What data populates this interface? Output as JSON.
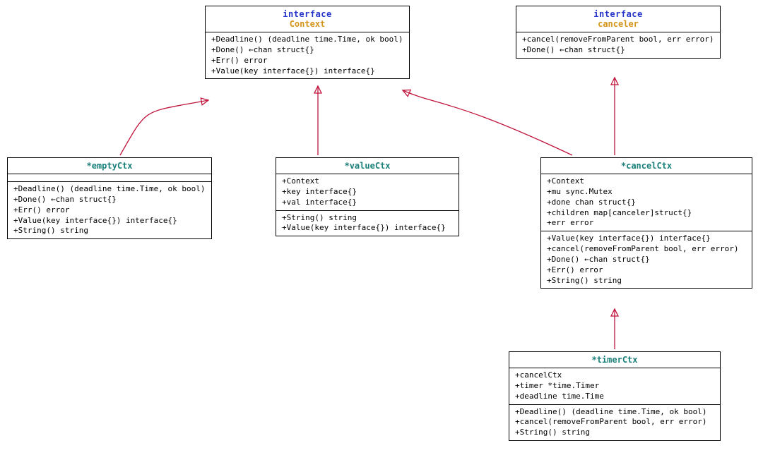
{
  "stereotype_label": "interface",
  "boxes": {
    "context": {
      "name": "Context",
      "methods": "+Deadline() (deadline time.Time, ok bool)\n+Done() ←chan struct{}\n+Err() error\n+Value(key interface{}) interface{}"
    },
    "canceler": {
      "name": "canceler",
      "methods": "+cancel(removeFromParent bool, err error)\n+Done() ←chan struct{}"
    },
    "emptyCtx": {
      "name": "*emptyCtx",
      "methods": "+Deadline() (deadline time.Time, ok bool)\n+Done() ←chan struct{}\n+Err() error\n+Value(key interface{}) interface{}\n+String() string"
    },
    "valueCtx": {
      "name": "*valueCtx",
      "fields": "+Context\n+key interface{}\n+val interface{}",
      "methods": "+String() string\n+Value(key interface{}) interface{}"
    },
    "cancelCtx": {
      "name": "*cancelCtx",
      "fields": "+Context\n+mu sync.Mutex\n+done chan struct{}\n+children map[canceler]struct{}\n+err error",
      "methods": "+Value(key interface{}) interface{}\n+cancel(removeFromParent bool, err error)\n+Done() ←chan struct{}\n+Err() error\n+String() string"
    },
    "timerCtx": {
      "name": "*timerCtx",
      "fields": "+cancelCtx\n+timer *time.Timer\n+deadline time.Time",
      "methods": "+Deadline() (deadline time.Time, ok bool)\n+cancel(removeFromParent bool, err error)\n+String() string"
    }
  }
}
